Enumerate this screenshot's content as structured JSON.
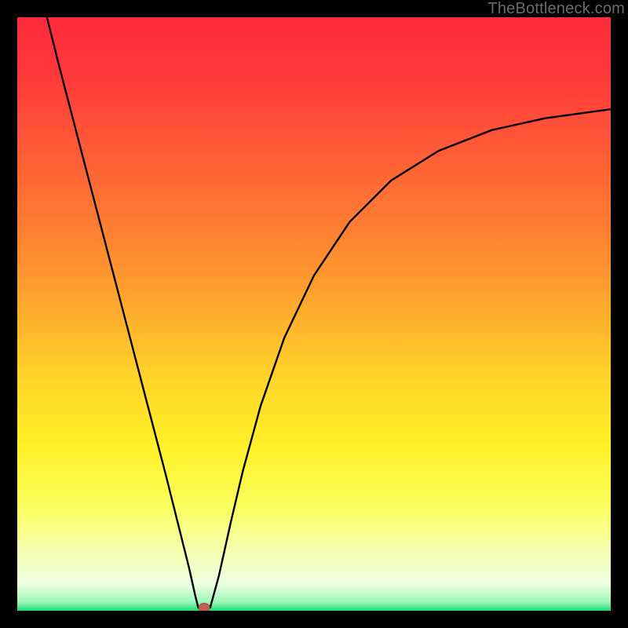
{
  "watermark": "TheBottleneck.com",
  "colors": {
    "frame": "#000000",
    "curve": "#000000",
    "marker_fill": "#c95f54",
    "marker_stroke": "#a84a40",
    "gradient_stops": [
      {
        "offset": 0.0,
        "color": "#ff2a3b"
      },
      {
        "offset": 0.1,
        "color": "#ff3a3a"
      },
      {
        "offset": 0.22,
        "color": "#ff5a36"
      },
      {
        "offset": 0.35,
        "color": "#ff7d32"
      },
      {
        "offset": 0.48,
        "color": "#ffa62e"
      },
      {
        "offset": 0.6,
        "color": "#ffd22a"
      },
      {
        "offset": 0.72,
        "color": "#fff027"
      },
      {
        "offset": 0.82,
        "color": "#fbff5a"
      },
      {
        "offset": 0.9,
        "color": "#f5ffb0"
      },
      {
        "offset": 0.955,
        "color": "#eeffe0"
      },
      {
        "offset": 0.985,
        "color": "#9ef7b9"
      },
      {
        "offset": 1.0,
        "color": "#18e070"
      }
    ]
  },
  "chart_data": {
    "type": "line",
    "title": "",
    "xlabel": "",
    "ylabel": "",
    "xlim": [
      0,
      100
    ],
    "ylim": [
      0,
      100
    ],
    "grid": false,
    "marker": {
      "x": 31.5,
      "y": 0
    },
    "left_branch": [
      {
        "x": 5.0,
        "y": 100.0
      },
      {
        "x": 7.0,
        "y": 92.0
      },
      {
        "x": 10.0,
        "y": 80.5
      },
      {
        "x": 13.0,
        "y": 69.0
      },
      {
        "x": 16.0,
        "y": 57.5
      },
      {
        "x": 19.0,
        "y": 46.0
      },
      {
        "x": 22.0,
        "y": 34.5
      },
      {
        "x": 25.0,
        "y": 23.0
      },
      {
        "x": 27.0,
        "y": 15.0
      },
      {
        "x": 29.0,
        "y": 7.0
      },
      {
        "x": 30.0,
        "y": 2.5
      },
      {
        "x": 30.5,
        "y": 0.5
      },
      {
        "x": 31.5,
        "y": 0.5
      },
      {
        "x": 32.5,
        "y": 0.5
      }
    ],
    "right_branch": [
      {
        "x": 32.5,
        "y": 0.5
      },
      {
        "x": 34.0,
        "y": 6.0
      },
      {
        "x": 36.0,
        "y": 15.0
      },
      {
        "x": 38.0,
        "y": 23.5
      },
      {
        "x": 41.0,
        "y": 34.5
      },
      {
        "x": 45.0,
        "y": 46.0
      },
      {
        "x": 50.0,
        "y": 56.5
      },
      {
        "x": 56.0,
        "y": 65.5
      },
      {
        "x": 63.0,
        "y": 72.5
      },
      {
        "x": 71.0,
        "y": 77.5
      },
      {
        "x": 80.0,
        "y": 81.0
      },
      {
        "x": 89.0,
        "y": 83.0
      },
      {
        "x": 100.0,
        "y": 84.5
      }
    ]
  }
}
